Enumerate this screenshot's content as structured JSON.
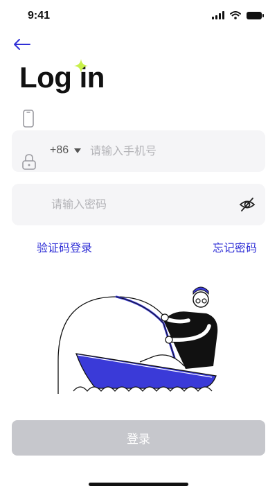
{
  "status_bar": {
    "time": "9:41"
  },
  "header": {
    "title": "Log in"
  },
  "phone": {
    "country_code": "+86",
    "placeholder": "请输入手机号",
    "value": ""
  },
  "password": {
    "placeholder": "请输入密码",
    "value": ""
  },
  "links": {
    "sms_login": "验证码登录",
    "forgot_password": "忘记密码"
  },
  "actions": {
    "login_label": "登录"
  },
  "colors": {
    "accent": "#2f2fd6",
    "sparkle": "#c8f04a",
    "field_background": "#f5f5f7",
    "button_disabled": "#c6c7cc",
    "boat": "#3a3ad8"
  },
  "icons": [
    "back-arrow-icon",
    "sparkle-icon",
    "phone-icon",
    "lock-icon",
    "caret-down-icon",
    "eye-off-icon"
  ]
}
